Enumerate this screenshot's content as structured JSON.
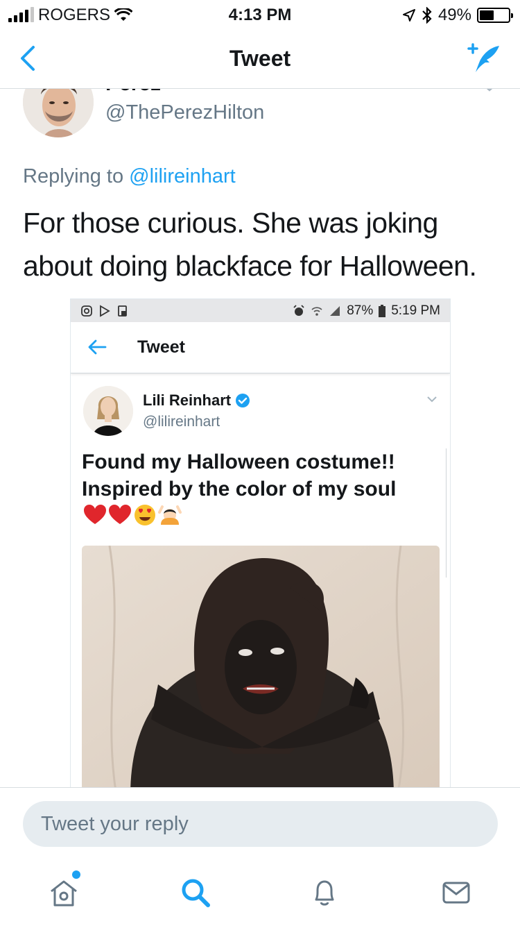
{
  "status_bar": {
    "carrier": "ROGERS",
    "time": "4:13 PM",
    "battery": "49%",
    "battery_level": 0.49
  },
  "nav": {
    "title": "Tweet",
    "icons": {
      "back": "chevron-left-icon",
      "compose": "compose-tweet-icon"
    }
  },
  "tweet": {
    "author_name": "Perez",
    "author_handle": "@ThePerezHilton",
    "replying_prefix": "Replying to ",
    "replying_to": "@lilireinhart",
    "text": "For those curious. She was joking about doing blackface for Halloween."
  },
  "embedded": {
    "status": {
      "battery": "87%",
      "time": "5:19 PM"
    },
    "nav_title": "Tweet",
    "author_name": "Lili Reinhart",
    "author_handle": "@lilireinhart",
    "text": "Found my Halloween costume!! Inspired by the color of my soul",
    "emojis": [
      "red-heart",
      "red-heart",
      "heart-eyes-face",
      "person-raising-hands"
    ]
  },
  "reply": {
    "placeholder": "Tweet your reply"
  },
  "tab_bar": {
    "tabs": [
      "home-icon",
      "search-icon",
      "notifications-icon",
      "messages-icon"
    ]
  },
  "colors": {
    "accent": "#1da1f2",
    "secondary_text": "#657786",
    "primary_text": "#14171a"
  }
}
